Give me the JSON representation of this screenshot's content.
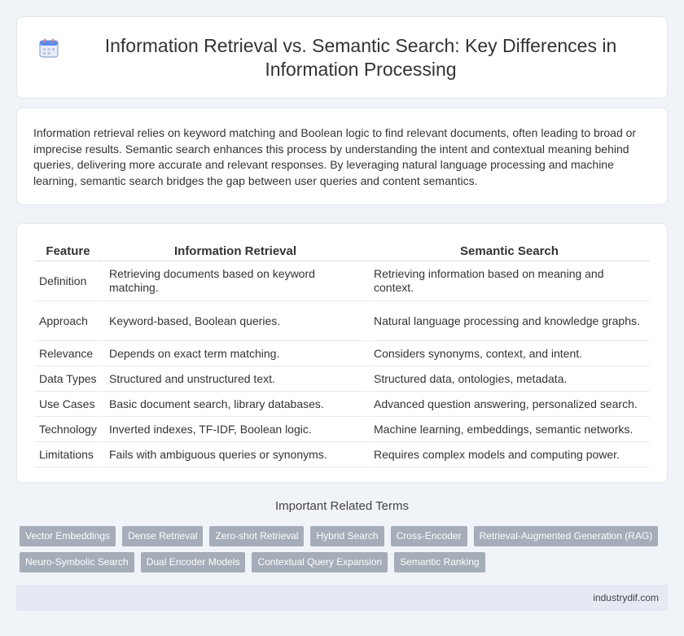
{
  "header": {
    "title": "Information Retrieval vs. Semantic Search: Key Differences in Information Processing",
    "icon": "calendar-icon"
  },
  "intro": {
    "text": "Information retrieval relies on keyword matching and Boolean logic to find relevant documents, often leading to broad or imprecise results. Semantic search enhances this process by understanding the intent and contextual meaning behind queries, delivering more accurate and relevant responses. By leveraging natural language processing and machine learning, semantic search bridges the gap between user queries and content semantics."
  },
  "table": {
    "headers": [
      "Feature",
      "Information Retrieval",
      "Semantic Search"
    ],
    "rows": [
      [
        "Definition",
        "Retrieving documents based on keyword matching.",
        "Retrieving information based on meaning and context."
      ],
      [
        "Approach",
        "Keyword-based, Boolean queries.",
        "Natural language processing and knowledge graphs."
      ],
      [
        "Relevance",
        "Depends on exact term matching.",
        "Considers synonyms, context, and intent."
      ],
      [
        "Data Types",
        "Structured and unstructured text.",
        "Structured data, ontologies, metadata."
      ],
      [
        "Use Cases",
        "Basic document search, library databases.",
        "Advanced question answering, personalized search."
      ],
      [
        "Technology",
        "Inverted indexes, TF-IDF, Boolean logic.",
        "Machine learning, embeddings, semantic networks."
      ],
      [
        "Limitations",
        "Fails with ambiguous queries or synonyms.",
        "Requires complex models and computing power."
      ]
    ]
  },
  "related": {
    "title": "Important Related Terms",
    "tags": [
      "Vector Embeddings",
      "Dense Retrieval",
      "Zero-shot Retrieval",
      "Hybrid Search",
      "Cross-Encoder",
      "Retrieval-Augmented Generation (RAG)",
      "Neuro-Symbolic Search",
      "Dual Encoder Models",
      "Contextual Query Expansion",
      "Semantic Ranking"
    ]
  },
  "footer": {
    "source": "industrydif.com"
  },
  "colors": {
    "background": "#f0f3f8",
    "tag": "#a5adb8",
    "footer": "#e4e9f3",
    "icon_accent": "#5b8def"
  }
}
